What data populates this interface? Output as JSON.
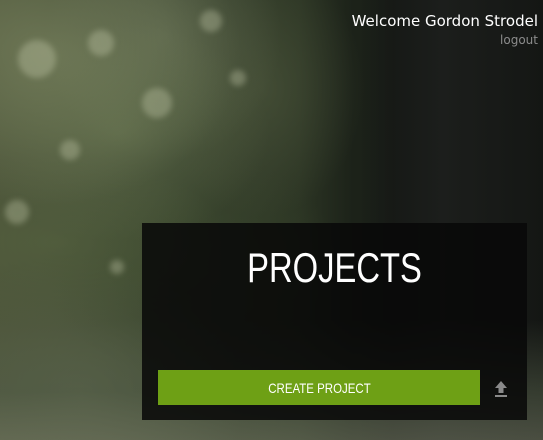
{
  "header": {
    "welcome_text": "Welcome Gordon Strodel",
    "logout_label": "logout"
  },
  "panel": {
    "title": "PROJECTS",
    "create_button_label": "CREATE PROJECT",
    "upload_icon": "upload-icon"
  },
  "colors": {
    "accent_green": "#6ea015",
    "panel_background": "#080808",
    "logout_gray": "#8c8c8c"
  }
}
